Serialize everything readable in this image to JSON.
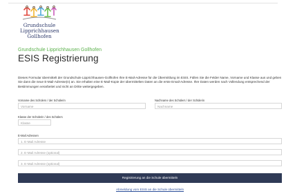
{
  "logo": {
    "line1": "Grundschule",
    "line2": "Lipprichhausen",
    "line3": "Gollhofen"
  },
  "header": {
    "school": "Grundschule Lipprichhausen Gollhofen",
    "title": "ESIS Registrierung"
  },
  "intro": "Dieses Formular übermittelt der Grundschule Lipprichhausen-Gollhofen Ihre E-Mail-Adresse für die Übermittlung im ESIS. Füllen Sie die Felder Name, Vorname und Klasse aus und geben Sie dann die neue E-Mail-Adresse(n) an. Sie erhalten eine E-Mail-Kopie der übermittelten Daten an die erste Email-Adresse. Ihre Daten werden nach Vollendung entsprechend der Bestimmungen verarbeitet und nicht an Dritte weitergegeben.",
  "form": {
    "firstname_label": "Vorname des Schülers / der Schülerin",
    "firstname_placeholder": "Vorname",
    "lastname_label": "Nachname des Schülers / der Schülerin",
    "lastname_placeholder": "Nachname",
    "class_label": "Klasse der Schülerin / des Schülers",
    "class_placeholder": "Klasse",
    "emails_label": "E-Mail Adressen",
    "email1_placeholder": "1. E-Mail Adresse",
    "email2_placeholder": "2. E-Mail Adresse (optional)",
    "email3_placeholder": "3. E-Mail Adresse (optional)"
  },
  "submit_label": "Registrierung an die Schule übermitteln",
  "logout_link": "Abmeldung vom ESIS an die Schule übermitteln",
  "colors": {
    "school_green": "#5bb14c",
    "button_navy": "#2f3a56",
    "link_blue": "#2c4f9a"
  }
}
